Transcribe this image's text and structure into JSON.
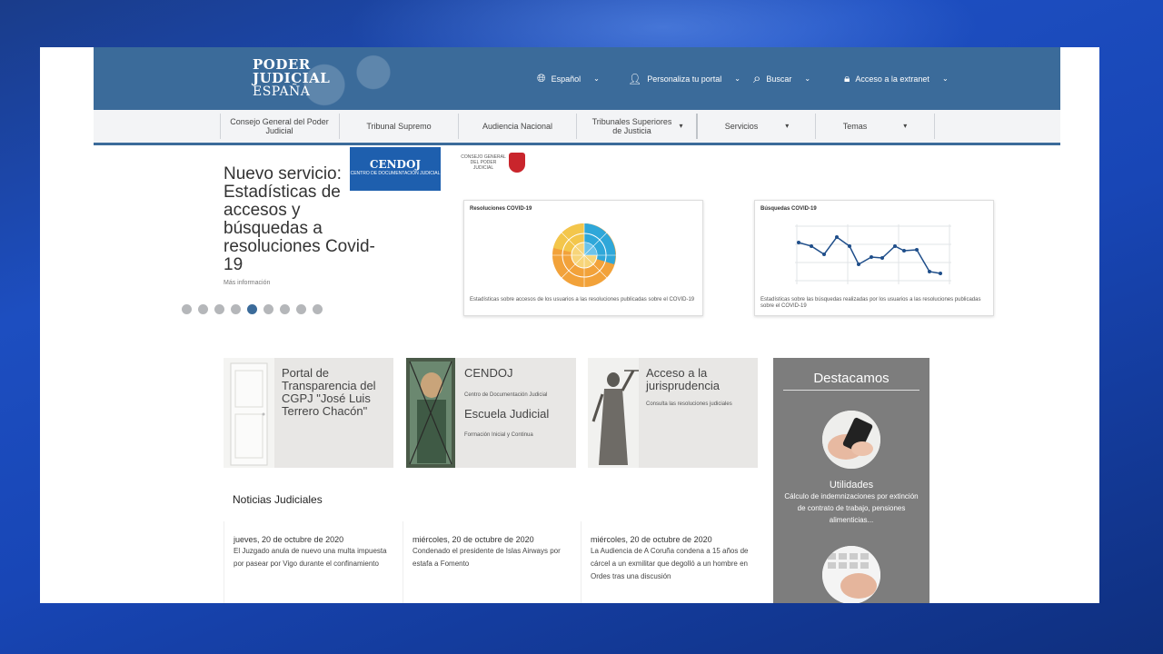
{
  "header": {
    "logo": {
      "line1": "PODER",
      "line2": "JUDICIAL",
      "line3": "ESPAÑA"
    },
    "nav": [
      {
        "icon": "globe-icon",
        "label": "Español"
      },
      {
        "icon": "user-icon",
        "label": "Personaliza tu portal"
      },
      {
        "icon": "search-icon",
        "label": "Buscar"
      },
      {
        "icon": "lock-icon",
        "label": "Acceso a la extranet"
      }
    ]
  },
  "menu": [
    {
      "label": "Consejo General del Poder Judicial"
    },
    {
      "label": "Tribunal Supremo"
    },
    {
      "label": "Audiencia Nacional"
    },
    {
      "label": "Tribunales Superiores de Justicia"
    },
    {
      "label": "Servicios"
    },
    {
      "label": "Temas"
    }
  ],
  "carousel": {
    "cendoj_logo": {
      "title": "CENDOJ",
      "subtitle": "CENTRO DE DOCUMENTACIÓN JUDICIAL"
    },
    "cgpj_logo": "CONSEJO GENERAL DEL PODER JUDICIAL",
    "title": "Nuevo servicio: Estadísticas de accesos y búsquedas a resoluciones Covid-19",
    "more": "Más información",
    "dots": 9,
    "active_dot": 5,
    "cards": [
      {
        "title": "Resoluciones COVID-19",
        "description": "Estadísticas sobre accesos de los usuarios a las resoluciones publicadas sobre el COVID-19"
      },
      {
        "title": "Búsquedas COVID-19",
        "description": "Estadísticas sobre las búsquedas realizadas por los usuarios a las resoluciones publicadas sobre el COVID-19"
      }
    ]
  },
  "tiles": [
    {
      "title": "Portal de Transparencia del CGPJ \"José Luis Terrero Chacón\"",
      "subtitle": ""
    },
    {
      "title": "CENDOJ",
      "subtitle": "Centro de Documentación Judicial",
      "title2": "Escuela Judicial",
      "subtitle2": "Formación Inicial y Continua"
    },
    {
      "title": "Acceso a la jurisprudencia",
      "subtitle": "Consulta las resoluciones judiciales"
    }
  ],
  "destacamos": {
    "heading": "Destacamos",
    "item_title": "Utilidades",
    "item_desc": "Cálculo de indemnizaciones por extinción de contrato de trabajo, pensiones alimenticias..."
  },
  "news": {
    "heading": "Noticias Judiciales",
    "items": [
      {
        "date": "jueves, 20 de octubre de 2020",
        "text": "El Juzgado anula de nuevo una multa impuesta por pasear por Vigo durante el confinamiento"
      },
      {
        "date": "miércoles, 20 de octubre de 2020",
        "text": "Condenado el presidente de Islas Airways por estafa a Fomento"
      },
      {
        "date": "miércoles, 20 de octubre de 2020",
        "text": "La Audiencia de A Coruña condena a 15 años de cárcel a un exmilitar que degolló a un hombre en Ordes tras una discusión"
      }
    ]
  },
  "colors": {
    "brand_blue": "#3b6b9a",
    "cendoj_blue": "#1e5fae",
    "destacamos_gray": "#7d7d7d"
  }
}
